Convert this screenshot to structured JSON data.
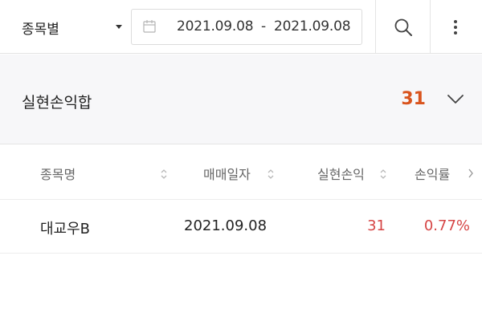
{
  "filter": {
    "selector_label": "종목별",
    "date_start": "2021.09.08",
    "date_separator": "-",
    "date_end": "2021.09.08"
  },
  "summary": {
    "label": "실현손익합",
    "value": "31"
  },
  "table": {
    "headers": [
      "종목명",
      "매매일자",
      "실현손익",
      "손익률"
    ],
    "rows": [
      {
        "name": "대교우B",
        "date": "2021.09.08",
        "pnl": "31",
        "rate": "0.77%"
      }
    ]
  },
  "colors": {
    "accent_total": "#d9541e",
    "profit": "#d64545"
  },
  "icons": [
    "dropdown-caret-icon",
    "calendar-icon",
    "search-icon",
    "more-vertical-icon",
    "chevron-down-icon",
    "sort-icon",
    "chevron-right-icon"
  ]
}
